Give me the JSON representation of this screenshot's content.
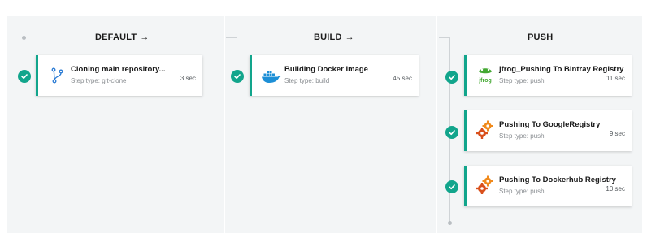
{
  "stages": {
    "default": {
      "title": "DEFAULT",
      "arrow": "→"
    },
    "build": {
      "title": "BUILD",
      "arrow": "→"
    },
    "push": {
      "title": "PUSH"
    }
  },
  "steps": [
    {
      "name": "Cloning main repository...",
      "type": "Step type: git-clone",
      "duration": "3 sec",
      "icon": "git-branch-icon",
      "status": "success"
    },
    {
      "name": "Building Docker Image",
      "type": "Step type: build",
      "duration": "45 sec",
      "icon": "docker-icon",
      "status": "success"
    },
    {
      "name": "jfrog_Pushing To Bintray Registry",
      "type": "Step type: push",
      "duration": "11 sec",
      "icon": "jfrog-icon",
      "icon_text": "jfrog",
      "status": "success"
    },
    {
      "name": "Pushing To GoogleRegistry",
      "type": "Step type: push",
      "duration": "9 sec",
      "icon": "gears-icon",
      "status": "success"
    },
    {
      "name": "Pushing To Dockerhub Registry",
      "type": "Step type: push",
      "duration": "10 sec",
      "icon": "gears-icon",
      "status": "success"
    }
  ],
  "colors": {
    "accent": "#12a58c",
    "column_bg": "#f3f5f6",
    "gear_orange": "#f08a1c",
    "gear_red": "#d9501c",
    "docker_blue": "#1d8fd6",
    "jfrog_green": "#44a833"
  }
}
